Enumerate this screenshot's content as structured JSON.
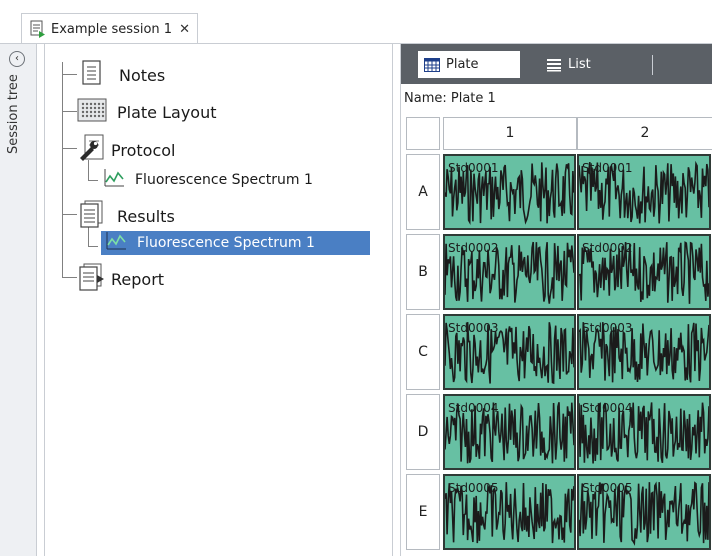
{
  "document_tab": {
    "title": "Example session 1",
    "close_glyph": "✕"
  },
  "rail": {
    "label": "Session tree",
    "collapse_glyph": "‹"
  },
  "tree": {
    "items": [
      {
        "label": "Notes",
        "icon": "notes-icon"
      },
      {
        "label": "Plate Layout",
        "icon": "plate-layout-icon"
      },
      {
        "label": "Protocol",
        "icon": "protocol-wrench-icon"
      },
      {
        "label": "Fluorescence Spectrum 1",
        "icon": "spectrum-chart-icon"
      },
      {
        "label": "Results",
        "icon": "results-icon"
      },
      {
        "label": "Fluorescence Spectrum 1",
        "icon": "spectrum-chart-icon",
        "selected": true
      },
      {
        "label": "Report",
        "icon": "report-icon"
      }
    ]
  },
  "plate_view": {
    "tabs": [
      {
        "label": "Plate",
        "icon": "plate-grid-icon",
        "active": true
      },
      {
        "label": "List",
        "icon": "list-icon",
        "active": false
      }
    ],
    "name_text": "Name: Plate 1",
    "columns": [
      "1",
      "2"
    ],
    "rows": [
      "A",
      "B",
      "C",
      "D",
      "E"
    ],
    "wells": [
      [
        "Std0001",
        "Std0001"
      ],
      [
        "Std0002",
        "Std0002"
      ],
      [
        "Std0003",
        "Std0003"
      ],
      [
        "Std0004",
        "Std0004"
      ],
      [
        "Std0005",
        "Std0005"
      ]
    ],
    "well_color": "#67c0a3",
    "trace_color": "#1b1b1b"
  },
  "colors": {
    "selection": "#4a7fc4",
    "toolbar_dark": "#5b6066",
    "rail_bg": "#eef0f3"
  }
}
